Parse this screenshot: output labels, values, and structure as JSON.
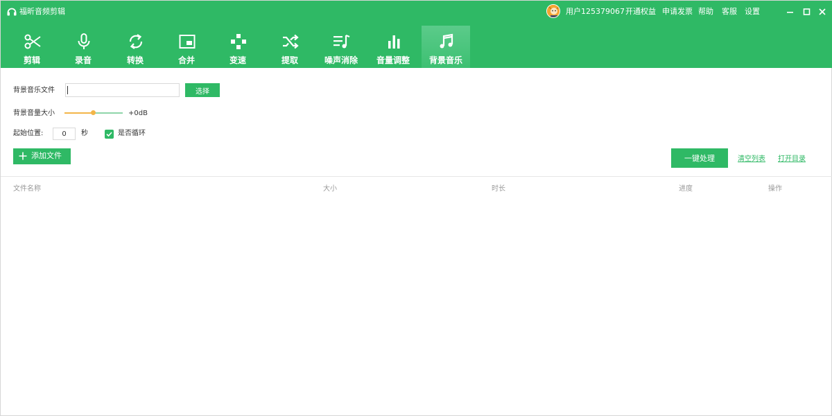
{
  "app": {
    "title": "福昕音频剪辑"
  },
  "topbar": {
    "user": "用户125379067",
    "links": [
      "开通权益",
      "申请发票",
      "帮助",
      "客服",
      "设置"
    ]
  },
  "tabs": [
    {
      "label": "剪辑",
      "icon": "scissors-icon"
    },
    {
      "label": "录音",
      "icon": "microphone-icon"
    },
    {
      "label": "转换",
      "icon": "sync-icon"
    },
    {
      "label": "合并",
      "icon": "merge-icon"
    },
    {
      "label": "变速",
      "icon": "gamepad-icon"
    },
    {
      "label": "提取",
      "icon": "shuffle-icon"
    },
    {
      "label": "噪声消除",
      "icon": "noise-list-icon"
    },
    {
      "label": "音量调整",
      "icon": "bar-chart-icon"
    },
    {
      "label": "背景音乐",
      "icon": "music-note-icon",
      "active": true
    }
  ],
  "settings": {
    "bgm_file_label": "背景音乐文件",
    "bgm_file_value": "",
    "select_button": "选择",
    "volume_label": "背景音量大小",
    "volume_value": "+0dB",
    "volume_level": 0.5,
    "start_label": "起始位置:",
    "start_value": "0",
    "start_unit": "秒",
    "loop_label": "是否循环",
    "loop_checked": true
  },
  "actions": {
    "add_file": "添加文件",
    "process": "一键处理",
    "clear_list": "清空列表",
    "open_dir": "打开目录"
  },
  "file_list": {
    "columns": [
      "文件名称",
      "大小",
      "时长",
      "进度",
      "操作"
    ],
    "rows": []
  },
  "colors": {
    "brand_green": "#2fb965",
    "slider_orange": "#f3b548"
  }
}
